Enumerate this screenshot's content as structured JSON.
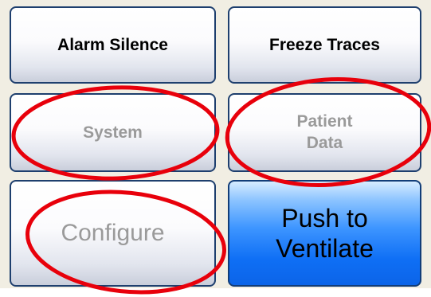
{
  "buttons": {
    "alarm_silence": "Alarm Silence",
    "freeze_traces": "Freeze Traces",
    "system": "System",
    "patient_data": "Patient\nData",
    "configure": "Configure",
    "push_to_ventilate": "Push to\nVentilate"
  },
  "colors": {
    "button_border": "#1e3f6e",
    "panel_background": "#f1eee3",
    "disabled_text": "#9a9a9a",
    "primary_button": "#0f6ff5",
    "annotation_circle": "#e8000b"
  }
}
